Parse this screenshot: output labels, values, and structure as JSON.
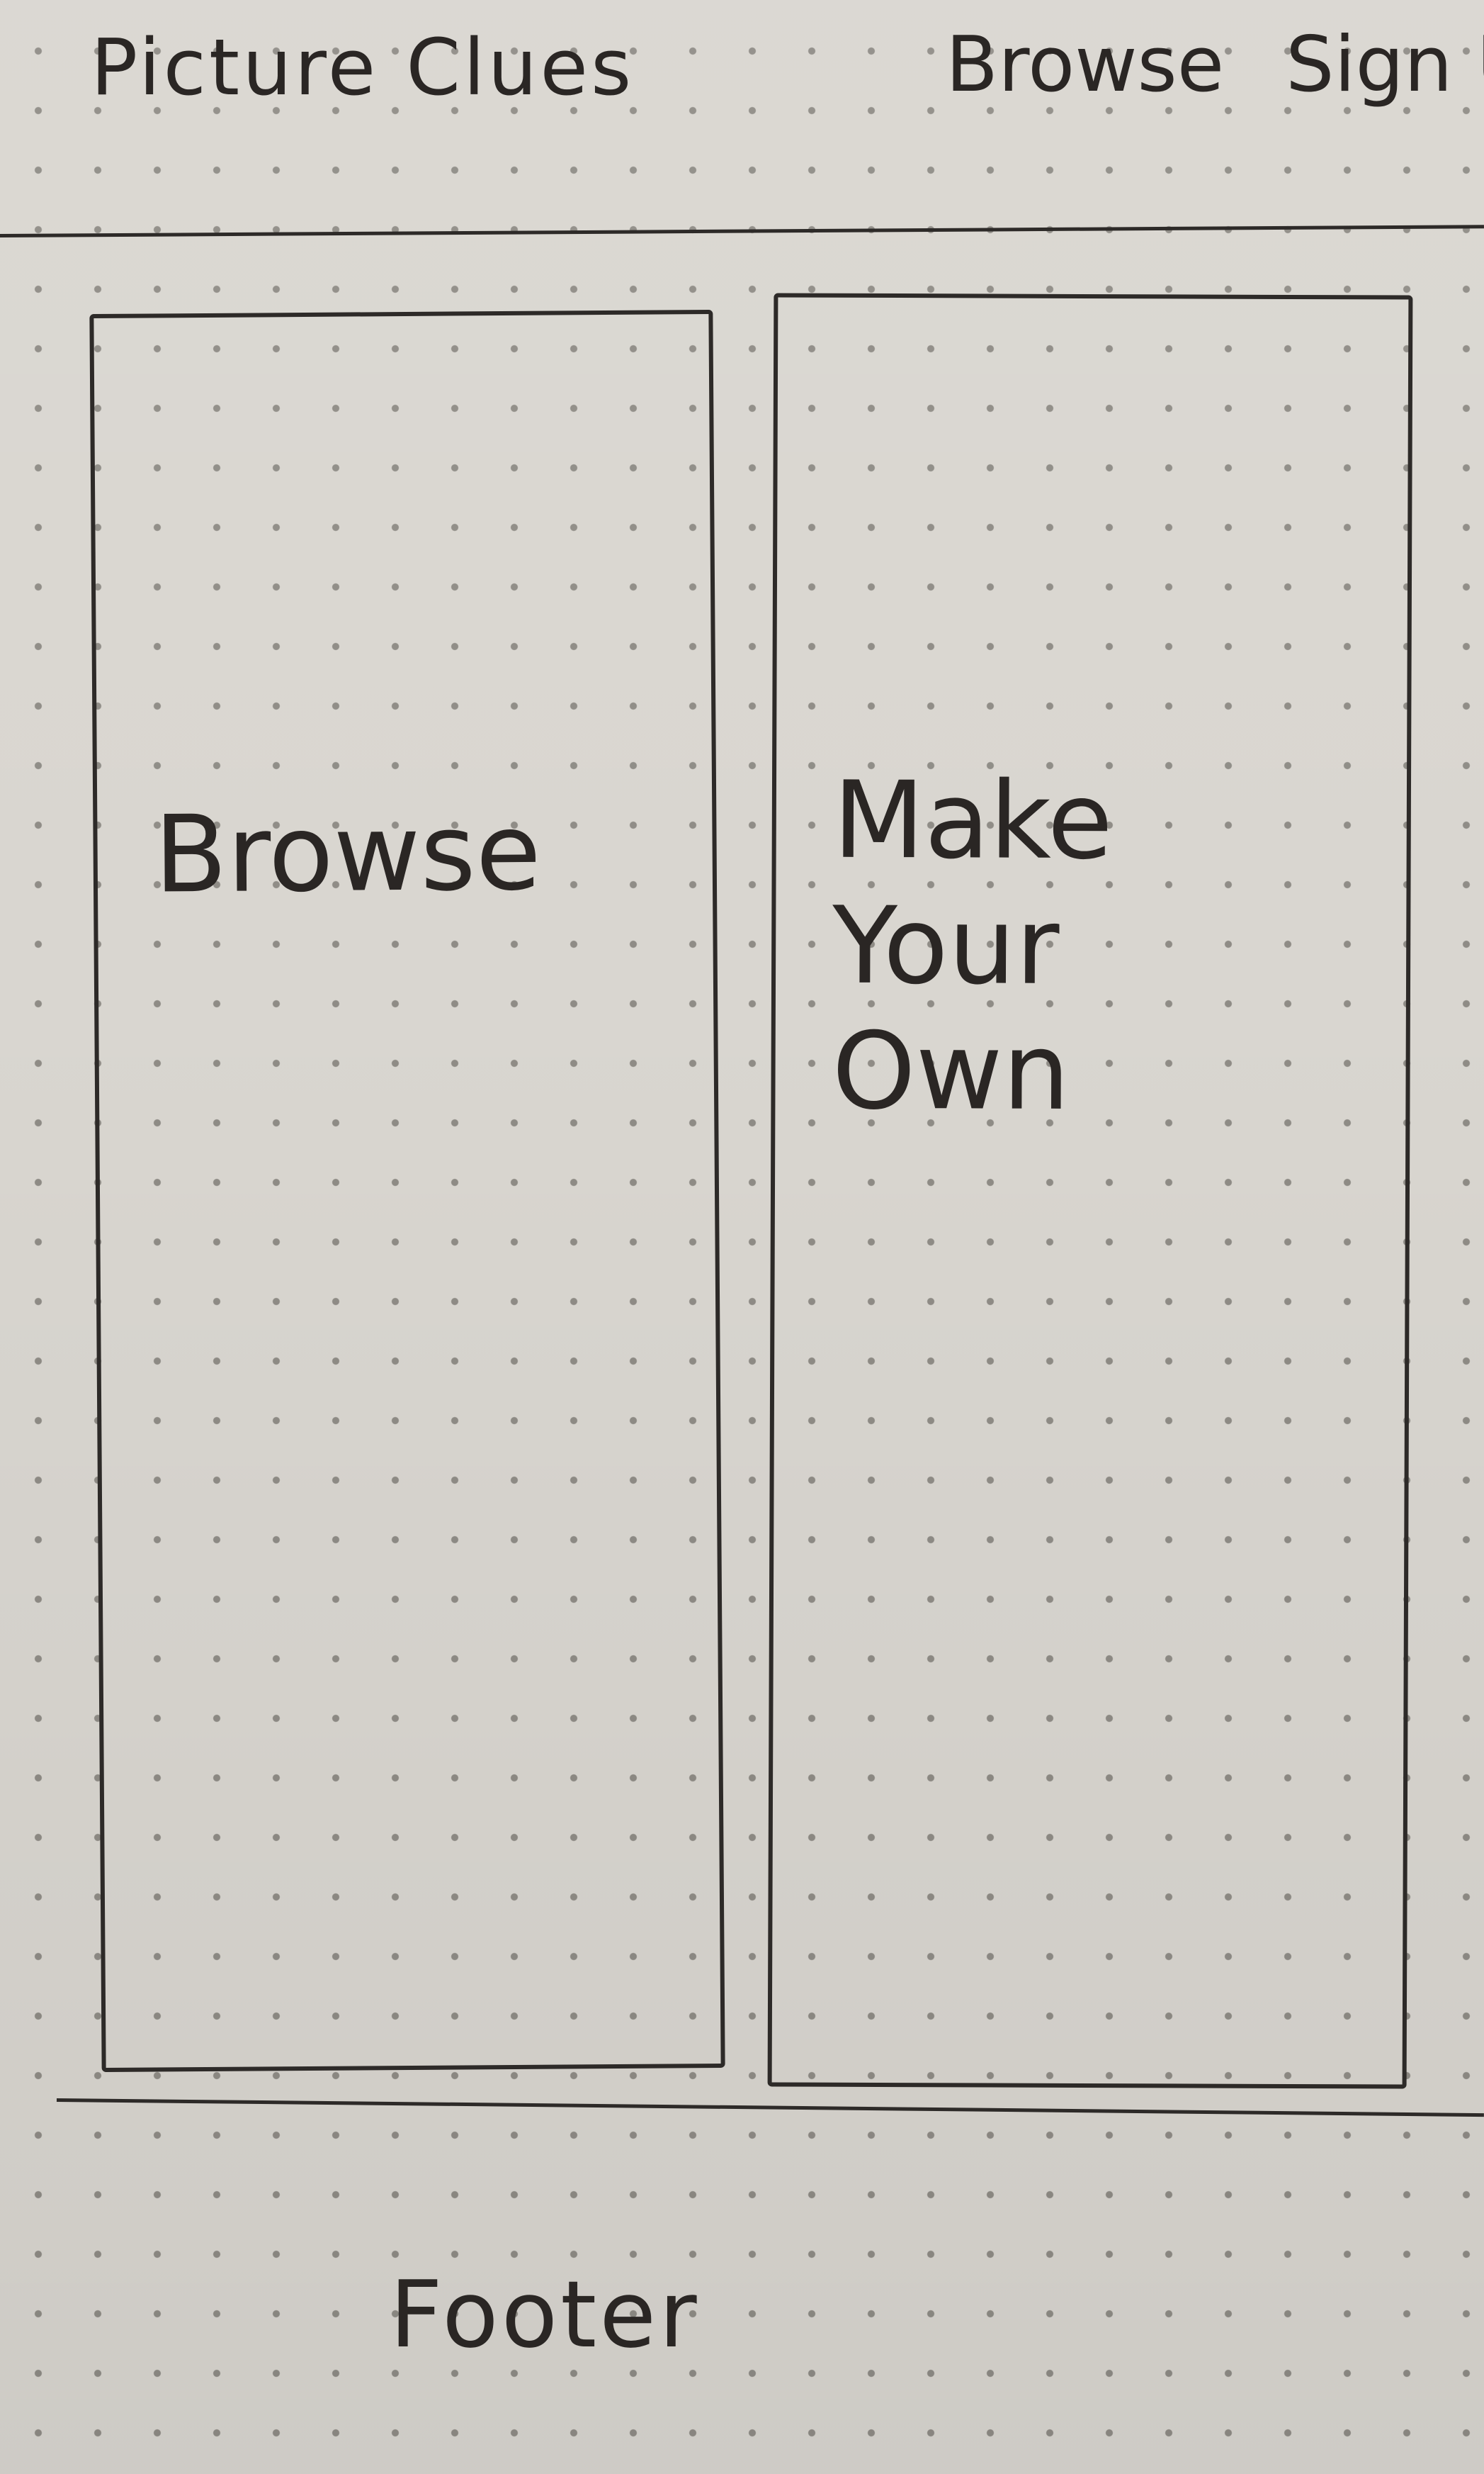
{
  "header": {
    "brand": "Picture Clues",
    "nav": {
      "browse_label": "Browse",
      "signin_label": "Sign U"
    }
  },
  "main": {
    "browse_card": {
      "label": "Browse"
    },
    "make_card": {
      "label_lines": [
        "Make",
        "Your",
        "Own"
      ]
    }
  },
  "footer": {
    "label": "Footer"
  }
}
